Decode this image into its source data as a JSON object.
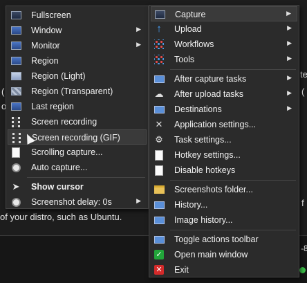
{
  "background": {
    "line_end": "of your distro, such as Ubuntu.",
    "fragments": [
      "(",
      "o",
      "te",
      "(",
      "f",
      "-8"
    ]
  },
  "capture_menu": {
    "items": [
      {
        "label": "Fullscreen",
        "icon": "fullscreen-icon"
      },
      {
        "label": "Window",
        "icon": "window-icon",
        "submenu": true
      },
      {
        "label": "Monitor",
        "icon": "monitor-icon",
        "submenu": true
      },
      {
        "label": "Region",
        "icon": "region-icon"
      },
      {
        "label": "Region (Light)",
        "icon": "region-light-icon"
      },
      {
        "label": "Region (Transparent)",
        "icon": "region-transparent-icon"
      },
      {
        "label": "Last region",
        "icon": "last-region-icon"
      },
      {
        "label": "Screen recording",
        "icon": "screen-recording-icon"
      },
      {
        "label": "Screen recording (GIF)",
        "icon": "gif-recording-icon",
        "highlighted": true
      },
      {
        "label": "Scrolling capture...",
        "icon": "scrolling-capture-icon"
      },
      {
        "label": "Auto capture...",
        "icon": "clock-icon"
      },
      {
        "label": "Show cursor",
        "icon": "cursor-icon",
        "bold": true
      },
      {
        "label": "Screenshot delay: 0s",
        "icon": "clock-icon",
        "submenu": true
      }
    ]
  },
  "main_menu": {
    "items": [
      {
        "label": "Capture",
        "icon": "capture-icon",
        "submenu": true,
        "highlighted": true
      },
      {
        "label": "Upload",
        "icon": "upload-arrow-icon",
        "submenu": true
      },
      {
        "label": "Workflows",
        "icon": "workflows-icon",
        "submenu": true
      },
      {
        "label": "Tools",
        "icon": "tools-icon",
        "submenu": true
      },
      {
        "label": "After capture tasks",
        "icon": "after-capture-icon",
        "submenu": true
      },
      {
        "label": "After upload tasks",
        "icon": "after-upload-icon",
        "submenu": true
      },
      {
        "label": "Destinations",
        "icon": "destinations-icon",
        "submenu": true
      },
      {
        "label": "Application settings...",
        "icon": "wrench-icon"
      },
      {
        "label": "Task settings...",
        "icon": "gear-icon"
      },
      {
        "label": "Hotkey settings...",
        "icon": "keyboard-icon"
      },
      {
        "label": "Disable hotkeys",
        "icon": "disable-hotkeys-icon"
      },
      {
        "label": "Screenshots folder...",
        "icon": "folder-icon"
      },
      {
        "label": "History...",
        "icon": "history-icon"
      },
      {
        "label": "Image history...",
        "icon": "image-history-icon"
      },
      {
        "label": "Toggle actions toolbar",
        "icon": "toolbar-icon"
      },
      {
        "label": "Open main window",
        "icon": "checkmark-icon"
      },
      {
        "label": "Exit",
        "icon": "exit-icon"
      }
    ]
  },
  "colors": {
    "menu_bg": "#2b2b2b",
    "highlight": "#3a3a3a",
    "status_dot": "#3bbf49"
  }
}
